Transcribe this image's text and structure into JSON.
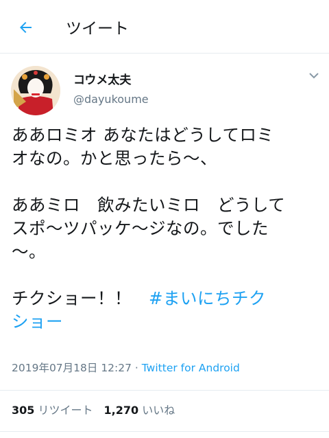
{
  "header": {
    "title": "ツイート",
    "back_icon": "arrow-left-icon"
  },
  "tweet": {
    "display_name": "コウメ太夫",
    "handle": "@dayukoume",
    "lines": [
      "ああロミオ あなたはどうしてロミ",
      "オなの。かと思ったら〜、",
      "",
      "ああミロ　飲みたいミロ　どうして",
      "スポ〜ツパッケ〜ジなの。でした",
      "〜。",
      ""
    ],
    "last_line_text": "チクショー！！　",
    "hashtag_part1": "#まいにちチク",
    "hashtag_part2": "ショー",
    "timestamp": "2019年07月18日 12:27 · ",
    "source": "Twitter for Android"
  },
  "stats": {
    "retweets_count": "305",
    "retweets_label": " リツイート",
    "likes_count": "1,270",
    "likes_label": " いいね"
  },
  "colors": {
    "accent": "#1da1f2",
    "secondary": "#657786",
    "text": "#14171a"
  }
}
